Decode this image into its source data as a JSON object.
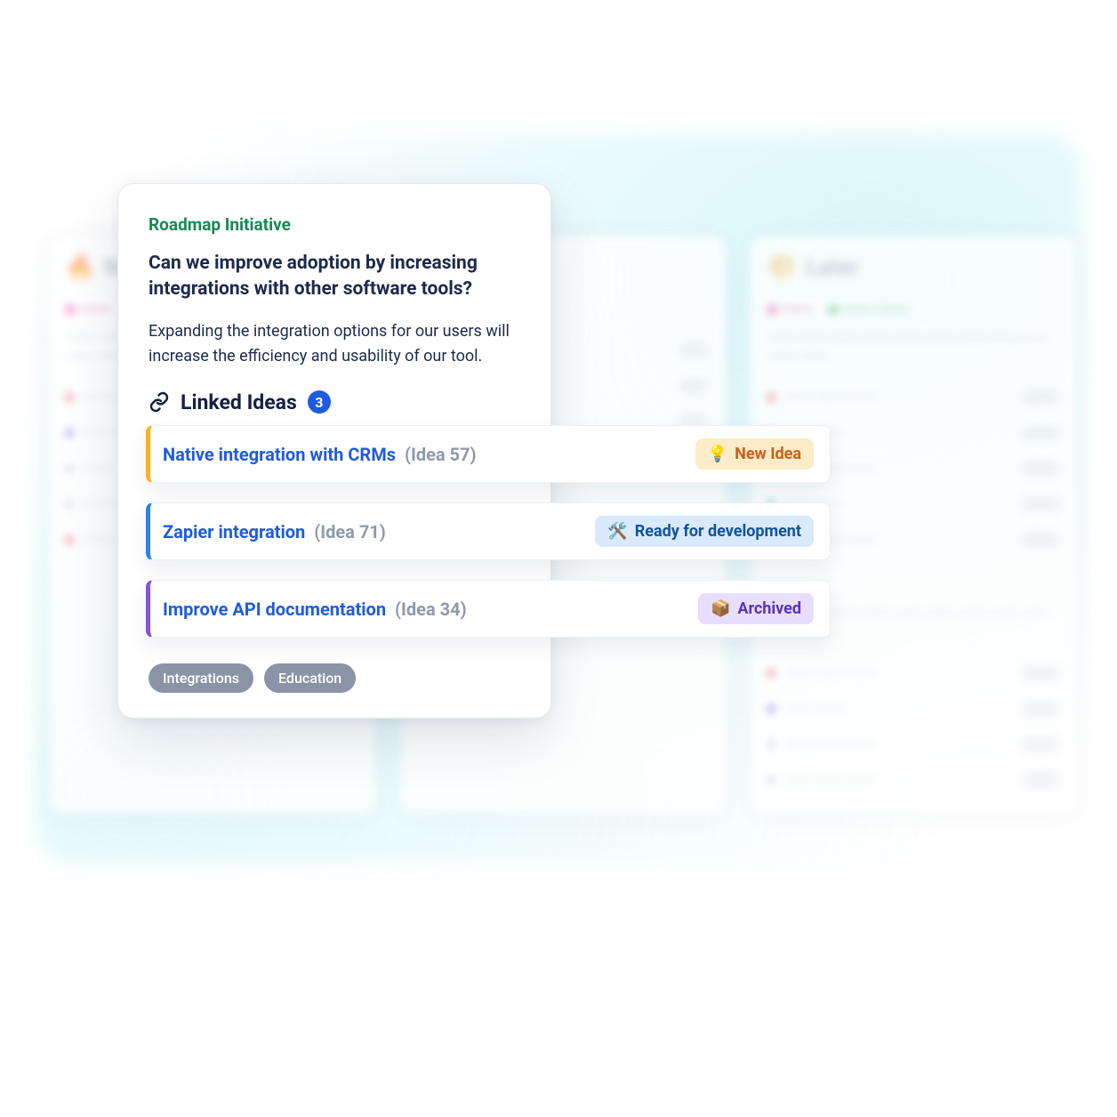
{
  "board": {
    "columns": [
      {
        "emoji": "🔥",
        "title": "Now"
      },
      {
        "emoji": "",
        "title": ""
      },
      {
        "emoji": "🌕",
        "title": "Later"
      }
    ]
  },
  "card": {
    "eyebrow": "Roadmap Initiative",
    "question": "Can we improve adoption by increasing integrations with other software tools?",
    "body": "Expanding the integration options for our users will increase the efficiency and usability of our tool.",
    "linked_label": "Linked Ideas",
    "linked_count": "3",
    "tags": [
      "Integrations",
      "Education"
    ]
  },
  "ideas": [
    {
      "title": "Native integration with CRMs",
      "id": "(Idea 57)",
      "status_emoji": "💡",
      "status": "New Idea",
      "status_kind": "newidea",
      "accent": "orange"
    },
    {
      "title": "Zapier integration",
      "id": "(Idea 71)",
      "status_emoji": "🛠️",
      "status": "Ready for development",
      "status_kind": "ready",
      "accent": "blue"
    },
    {
      "title": "Improve API documentation",
      "id": "(Idea 34)",
      "status_emoji": "📦",
      "status": "Archived",
      "status_kind": "archived",
      "accent": "purple"
    }
  ]
}
